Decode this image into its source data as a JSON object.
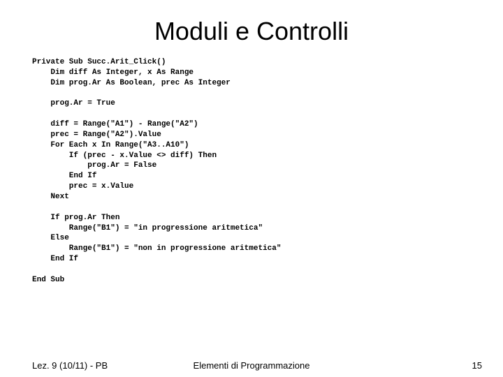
{
  "title": "Moduli e Controlli",
  "code": "Private Sub Succ.Arit_Click()\n    Dim diff As Integer, x As Range\n    Dim prog.Ar As Boolean, prec As Integer\n\n    prog.Ar = True\n\n    diff = Range(\"A1\") - Range(\"A2\")\n    prec = Range(\"A2\").Value\n    For Each x In Range(\"A3..A10\")\n        If (prec - x.Value <> diff) Then\n            prog.Ar = False\n        End If\n        prec = x.Value\n    Next\n\n    If prog.Ar Then\n        Range(\"B1\") = \"in progressione aritmetica\"\n    Else\n        Range(\"B1\") = \"non in progressione aritmetica\"\n    End If\n\nEnd Sub",
  "footer": {
    "left": "Lez. 9 (10/11) - PB",
    "center": "Elementi di Programmazione",
    "right": "15"
  }
}
